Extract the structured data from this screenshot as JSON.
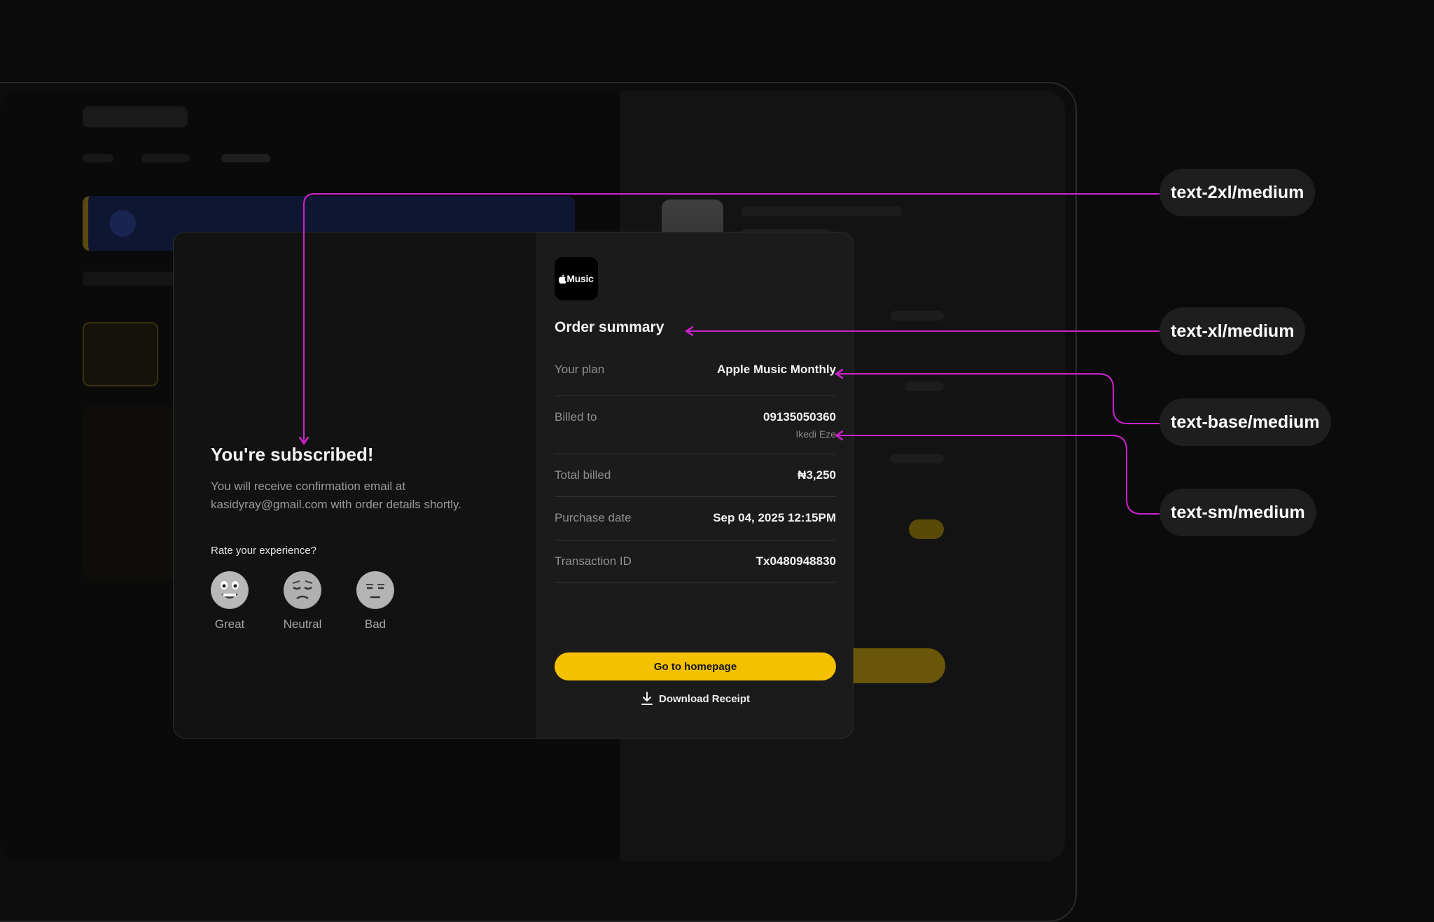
{
  "colors": {
    "background": "#0b0b0b",
    "modal_left": "#121212",
    "modal_right": "#1b1b1b",
    "accent_yellow": "#f3c100",
    "annotation_magenta": "#cc22cc"
  },
  "modal": {
    "success_title": "You're subscribed!",
    "success_message": "You will receive confirmation email at kasidyray@gmail.com with order details shortly.",
    "rate_label": "Rate your experience?",
    "ratings": [
      {
        "label": "Great",
        "icon": "grinning-face-icon"
      },
      {
        "label": "Neutral",
        "icon": "relieved-face-icon"
      },
      {
        "label": "Bad",
        "icon": "neutral-face-icon"
      }
    ],
    "app_logo_text": "Music",
    "order_title": "Order summary",
    "summary": [
      {
        "label": "Your plan",
        "value": "Apple Music Monthly",
        "sub": ""
      },
      {
        "label": "Billed to",
        "value": "09135050360",
        "sub": "Ikedi Eze"
      },
      {
        "label": "Total billed",
        "value": "₦3,250",
        "sub": ""
      },
      {
        "label": "Purchase date",
        "value": "Sep 04, 2025 12:15PM",
        "sub": ""
      },
      {
        "label": "Transaction ID",
        "value": "Tx0480948830",
        "sub": ""
      }
    ],
    "home_button_label": "Go to homepage",
    "download_label": "Download Receipt",
    "download_icon": "download-icon"
  },
  "annotations": [
    {
      "label": "text-2xl/medium"
    },
    {
      "label": "text-xl/medium"
    },
    {
      "label": "text-base/medium"
    },
    {
      "label": "text-sm/medium"
    }
  ]
}
